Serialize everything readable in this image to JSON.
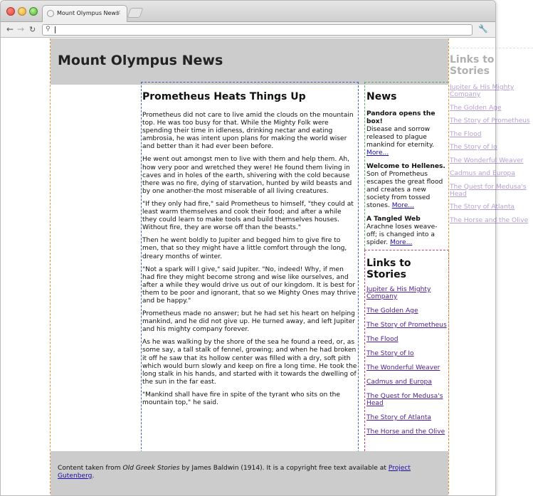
{
  "browser": {
    "tab_title": "Mount Olympus News",
    "tab_close": "×",
    "url": ""
  },
  "site": {
    "title": "Mount Olympus News"
  },
  "article": {
    "title": "Prometheus Heats Things Up",
    "paragraphs": [
      "Prometheus did not care to live amid the clouds on the mountain top. He was too busy for that. While the Mighty Folk were spending their time in idleness, drinking nectar and eating ambrosia, he was intent upon plans for making the world wiser and better than it had ever been before.",
      "He went out amongst men to live with them and help them. Ah, how very poor and wretched they were! He found them living in caves and in holes of the earth, shivering with the cold because there was no fire, dying of starvation, hunted by wild beasts and by one another-the most miserable of all living creatures.",
      "\"If they only had fire,\" said Prometheus to himself, \"they could at least warm themselves and cook their food; and after a while they could learn to make tools and build themselves houses. Without fire, they are worse off than the beasts.\"",
      "Then he went boldly to Jupiter and begged him to give fire to men, that so they might have a little comfort through the long, dreary months of winter.",
      "\"Not a spark will I give,\" said Jupiter. \"No, indeed! Why, if men had fire they might become strong and wise like ourselves, and after a while they would drive us out of our kingdom. It is best for them to be poor and ignorant, that so we Mighty Ones may thrive and be happy.\"",
      "Prometheus made no answer; but he had set his heart on helping mankind, and he did not give up. He turned away, and left Jupiter and his mighty company forever.",
      "As he was walking by the shore of the sea he found a reed, or, as some say, a tall stalk of fennel, growing; and when he had broken it off he saw that its hollow center was filled with a dry, soft pith which would burn slowly and keep on fire a long time. He took the long stalk in his hands, and started with it towards the dwelling of the sun in the far east.",
      "\"Mankind shall have fire in spite of the tyrant who sits on the mountain top,\" he said."
    ]
  },
  "news": {
    "title": "News",
    "items": [
      {
        "headline": "Pandora opens the box!",
        "body": "Disease and sorrow released to plague mankind for eternity.",
        "more": "More..."
      },
      {
        "headline": "Welcome to Hellenes.",
        "body": "Son of Prometheus escapes the great flood and creates a new society from tossed stones.",
        "more": "More..."
      },
      {
        "headline": "A Tangled Web",
        "body": "Arachne loses weave-off; is changed into a spider.",
        "more": "More..."
      }
    ]
  },
  "links": {
    "title": "Links to Stories",
    "items": [
      "Jupiter & His Mighty Company",
      "The Golden Age",
      "The Story of Prometheus",
      "The Flood",
      "The Story of Io",
      "The Wonderful Weaver",
      "Cadmus and Europa",
      "The Quest for Medusa's Head",
      "The Story of Atlanta",
      "The Horse and the Olive"
    ]
  },
  "footer": {
    "prefix": "Content taken from ",
    "book": "Old Greek Stories",
    "middle": " by James Baldwin (1914). It is a copyright free text available at ",
    "link": "Project Gutenberg",
    "suffix": "."
  }
}
